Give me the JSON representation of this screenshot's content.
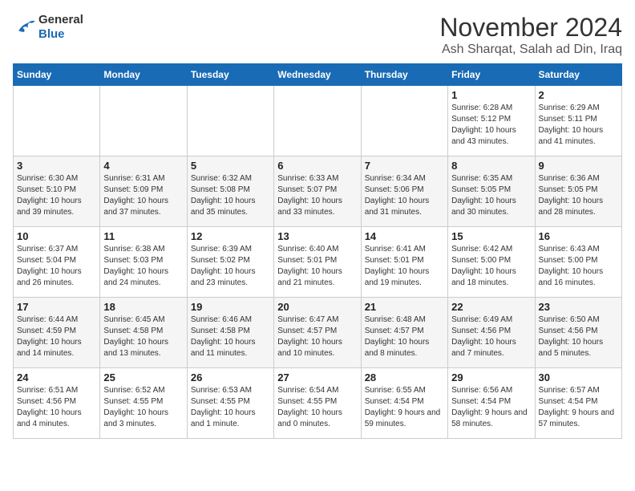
{
  "logo": {
    "text_general": "General",
    "text_blue": "Blue"
  },
  "title": "November 2024",
  "location": "Ash Sharqat, Salah ad Din, Iraq",
  "days_of_week": [
    "Sunday",
    "Monday",
    "Tuesday",
    "Wednesday",
    "Thursday",
    "Friday",
    "Saturday"
  ],
  "weeks": [
    [
      {
        "day": "",
        "info": ""
      },
      {
        "day": "",
        "info": ""
      },
      {
        "day": "",
        "info": ""
      },
      {
        "day": "",
        "info": ""
      },
      {
        "day": "",
        "info": ""
      },
      {
        "day": "1",
        "info": "Sunrise: 6:28 AM\nSunset: 5:12 PM\nDaylight: 10 hours and 43 minutes."
      },
      {
        "day": "2",
        "info": "Sunrise: 6:29 AM\nSunset: 5:11 PM\nDaylight: 10 hours and 41 minutes."
      }
    ],
    [
      {
        "day": "3",
        "info": "Sunrise: 6:30 AM\nSunset: 5:10 PM\nDaylight: 10 hours and 39 minutes."
      },
      {
        "day": "4",
        "info": "Sunrise: 6:31 AM\nSunset: 5:09 PM\nDaylight: 10 hours and 37 minutes."
      },
      {
        "day": "5",
        "info": "Sunrise: 6:32 AM\nSunset: 5:08 PM\nDaylight: 10 hours and 35 minutes."
      },
      {
        "day": "6",
        "info": "Sunrise: 6:33 AM\nSunset: 5:07 PM\nDaylight: 10 hours and 33 minutes."
      },
      {
        "day": "7",
        "info": "Sunrise: 6:34 AM\nSunset: 5:06 PM\nDaylight: 10 hours and 31 minutes."
      },
      {
        "day": "8",
        "info": "Sunrise: 6:35 AM\nSunset: 5:05 PM\nDaylight: 10 hours and 30 minutes."
      },
      {
        "day": "9",
        "info": "Sunrise: 6:36 AM\nSunset: 5:05 PM\nDaylight: 10 hours and 28 minutes."
      }
    ],
    [
      {
        "day": "10",
        "info": "Sunrise: 6:37 AM\nSunset: 5:04 PM\nDaylight: 10 hours and 26 minutes."
      },
      {
        "day": "11",
        "info": "Sunrise: 6:38 AM\nSunset: 5:03 PM\nDaylight: 10 hours and 24 minutes."
      },
      {
        "day": "12",
        "info": "Sunrise: 6:39 AM\nSunset: 5:02 PM\nDaylight: 10 hours and 23 minutes."
      },
      {
        "day": "13",
        "info": "Sunrise: 6:40 AM\nSunset: 5:01 PM\nDaylight: 10 hours and 21 minutes."
      },
      {
        "day": "14",
        "info": "Sunrise: 6:41 AM\nSunset: 5:01 PM\nDaylight: 10 hours and 19 minutes."
      },
      {
        "day": "15",
        "info": "Sunrise: 6:42 AM\nSunset: 5:00 PM\nDaylight: 10 hours and 18 minutes."
      },
      {
        "day": "16",
        "info": "Sunrise: 6:43 AM\nSunset: 5:00 PM\nDaylight: 10 hours and 16 minutes."
      }
    ],
    [
      {
        "day": "17",
        "info": "Sunrise: 6:44 AM\nSunset: 4:59 PM\nDaylight: 10 hours and 14 minutes."
      },
      {
        "day": "18",
        "info": "Sunrise: 6:45 AM\nSunset: 4:58 PM\nDaylight: 10 hours and 13 minutes."
      },
      {
        "day": "19",
        "info": "Sunrise: 6:46 AM\nSunset: 4:58 PM\nDaylight: 10 hours and 11 minutes."
      },
      {
        "day": "20",
        "info": "Sunrise: 6:47 AM\nSunset: 4:57 PM\nDaylight: 10 hours and 10 minutes."
      },
      {
        "day": "21",
        "info": "Sunrise: 6:48 AM\nSunset: 4:57 PM\nDaylight: 10 hours and 8 minutes."
      },
      {
        "day": "22",
        "info": "Sunrise: 6:49 AM\nSunset: 4:56 PM\nDaylight: 10 hours and 7 minutes."
      },
      {
        "day": "23",
        "info": "Sunrise: 6:50 AM\nSunset: 4:56 PM\nDaylight: 10 hours and 5 minutes."
      }
    ],
    [
      {
        "day": "24",
        "info": "Sunrise: 6:51 AM\nSunset: 4:56 PM\nDaylight: 10 hours and 4 minutes."
      },
      {
        "day": "25",
        "info": "Sunrise: 6:52 AM\nSunset: 4:55 PM\nDaylight: 10 hours and 3 minutes."
      },
      {
        "day": "26",
        "info": "Sunrise: 6:53 AM\nSunset: 4:55 PM\nDaylight: 10 hours and 1 minute."
      },
      {
        "day": "27",
        "info": "Sunrise: 6:54 AM\nSunset: 4:55 PM\nDaylight: 10 hours and 0 minutes."
      },
      {
        "day": "28",
        "info": "Sunrise: 6:55 AM\nSunset: 4:54 PM\nDaylight: 9 hours and 59 minutes."
      },
      {
        "day": "29",
        "info": "Sunrise: 6:56 AM\nSunset: 4:54 PM\nDaylight: 9 hours and 58 minutes."
      },
      {
        "day": "30",
        "info": "Sunrise: 6:57 AM\nSunset: 4:54 PM\nDaylight: 9 hours and 57 minutes."
      }
    ]
  ]
}
